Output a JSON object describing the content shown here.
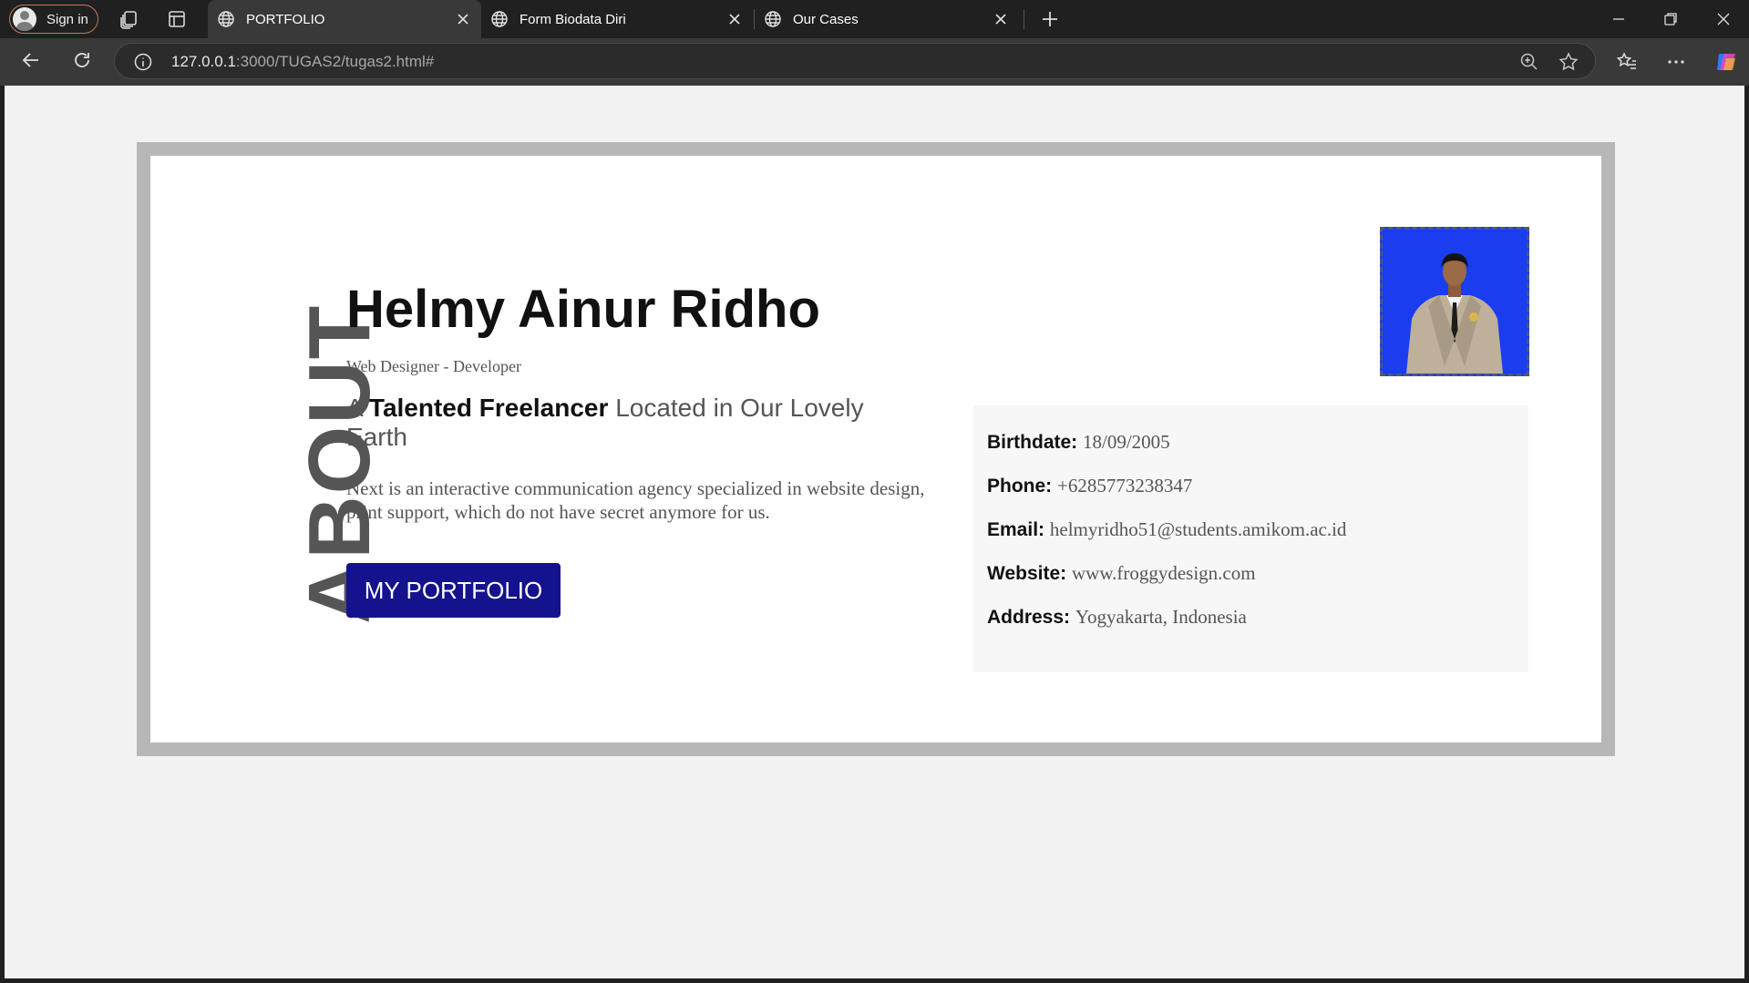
{
  "browser": {
    "signin_label": "Sign in",
    "tabs": [
      {
        "title": "PORTFOLIO",
        "active": true
      },
      {
        "title": "Form Biodata Diri",
        "active": false
      },
      {
        "title": "Our Cases",
        "active": false
      }
    ],
    "url_host": "127.0.0.1",
    "url_path": ":3000/TUGAS2/tugas2.html#"
  },
  "page": {
    "side_label": "ABOUT",
    "name": "Helmy Ainur Ridho",
    "role": "Web Designer - Developer",
    "tagline": {
      "prefix": "A",
      "bold": "Talented Freelancer",
      "suffix": "Located in Our Lovely Earth"
    },
    "description": "Next is an interactive communication agency specialized in website design, print support, which do not have secret anymore for us.",
    "button_label": "MY PORTFOLIO",
    "details": [
      {
        "label": "Birthdate:",
        "value": "18/09/2005"
      },
      {
        "label": "Phone:",
        "value": "+6285773238347"
      },
      {
        "label": "Email:",
        "value": "helmyridho51@students.amikom.ac.id"
      },
      {
        "label": "Website:",
        "value": "www.froggydesign.com"
      },
      {
        "label": "Address:",
        "value": "Yogyakarta, Indonesia"
      }
    ]
  },
  "colors": {
    "accent_button": "#15128e",
    "photo_background": "#1a3df0",
    "frame_border": "#b7b7b7"
  }
}
